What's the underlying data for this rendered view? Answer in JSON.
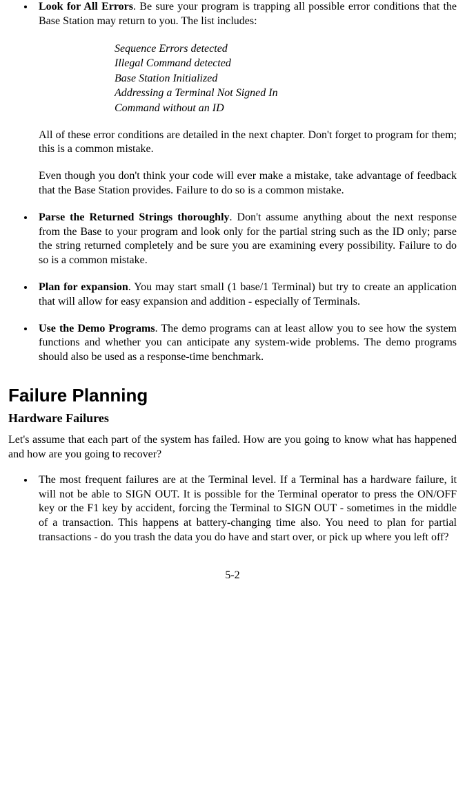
{
  "bullets": {
    "b1": {
      "title": "Look for All Errors",
      "text": ". Be sure your program is trapping all possible error conditions that the Base Station may return to you.  The list includes:"
    },
    "errors": {
      "e1": "Sequence Errors detected",
      "e2": "Illegal Command detected",
      "e3": "Base Station Initialized",
      "e4": "Addressing a Terminal Not Signed In",
      "e5": "Command without an ID"
    },
    "b1_after1": "All of these error conditions are detailed in the next chapter. Don't forget to program for them; this is a common mistake.",
    "b1_after2": "Even though you don't think your code will ever make a mistake, take advantage of feedback that the Base Station provides. Failure to do so is a common mistake.",
    "b2": {
      "title": "Parse the Returned Strings thoroughly",
      "text": ". Don't assume anything about the next response from the Base to your program and look only for the partial string such as the ID only; parse the string returned completely and be sure you are examining every possibility. Failure to do so is a common mistake."
    },
    "b3": {
      "title": "Plan for expansion",
      "text": ". You may start small (1 base/1 Terminal) but try to create an application that will allow for easy expansion and addition - especially of Terminals."
    },
    "b4": {
      "title": "Use the Demo Programs",
      "text": ". The demo programs can at least allow you to see how the system functions and whether you can anticipate any system-wide problems.  The demo programs should also be used as a response-time benchmark."
    }
  },
  "section": {
    "heading": "Failure Planning",
    "subheading": "Hardware Failures",
    "intro": "Let's assume that each part of the system has failed. How are you going to know what has happened and how are you going to recover?",
    "bullet1": "The most frequent failures are at the Terminal level. If a Terminal has a hardware failure, it will not be able to SIGN OUT. It is possible for the Terminal operator to press the ON/OFF key or the F1 key by accident, forcing the Terminal to SIGN OUT - sometimes in the middle of a transaction. This happens at battery-changing time also.  You need to plan for partial transactions - do you trash the data you do have and start over, or pick up where you left off?"
  },
  "page_number": "5-2"
}
